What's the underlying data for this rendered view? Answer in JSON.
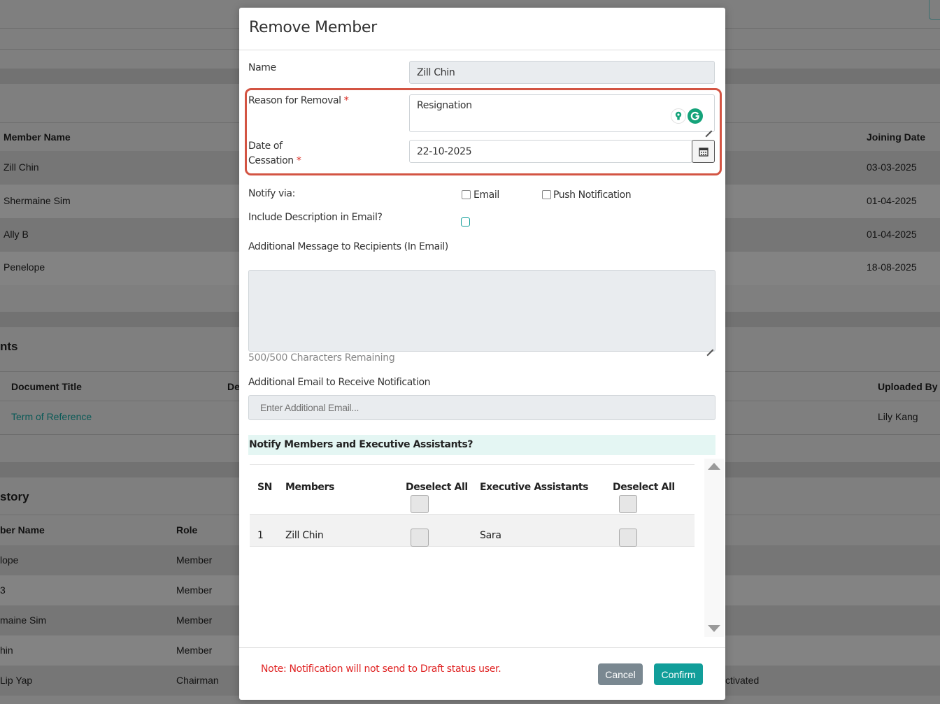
{
  "background": {
    "members_table": {
      "headers": [
        "Member Name",
        "Joining Date"
      ],
      "rows": [
        {
          "name": "Zill Chin",
          "date": "03-03-2025"
        },
        {
          "name": "Shermaine Sim",
          "date": "01-04-2025"
        },
        {
          "name": "Ally B",
          "date": "01-04-2025"
        },
        {
          "name": "Penelope",
          "date": "18-08-2025"
        }
      ]
    },
    "documents": {
      "heading_fragment": "nts",
      "headers": [
        "Document Title",
        "De",
        "Uploaded By"
      ],
      "row": {
        "title": "Term of Reference",
        "uploaded_by": "Lily Kang"
      }
    },
    "history": {
      "heading_fragment": "story",
      "headers": [
        "ber Name",
        "Role"
      ],
      "rows": [
        {
          "name": "lope",
          "role": "Member"
        },
        {
          "name": "3",
          "role": "Member"
        },
        {
          "name": "maine Sim",
          "role": "Member"
        },
        {
          "name": "hin",
          "role": "Member"
        },
        {
          "name": "Lip Yap",
          "role": "Chairman",
          "status": "ctivated"
        }
      ]
    }
  },
  "modal": {
    "title": "Remove Member",
    "name_label": "Name",
    "name_value": "Zill Chin",
    "reason_label": "Reason for Removal",
    "reason_value": "Resignation",
    "required_mark": "*",
    "date_label_line1": "Date of",
    "date_label_line2": "Cessation",
    "date_value": "22-10-2025",
    "notify_label": "Notify via:",
    "notify_email": "Email",
    "notify_push": "Push Notification",
    "include_desc_label": "Include Description in Email?",
    "additional_msg_label": "Additional Message to Recipients (In Email)",
    "additional_msg_value": "",
    "chars_remaining": "500/500 Characters Remaining",
    "additional_email_label": "Additional Email to Receive Notification",
    "additional_email_placeholder": "Enter Additional Email...",
    "notify_members_heading": "Notify Members and Executive Assistants?",
    "table": {
      "headers": {
        "sn": "SN",
        "members": "Members",
        "deselect_members": "Deselect All",
        "assistants": "Executive Assistants",
        "deselect_assistants": "Deselect All"
      },
      "rows": [
        {
          "sn": "1",
          "member": "Zill Chin",
          "assistant": "Sara"
        }
      ]
    },
    "note": "Note: Notification will not send to Draft status user.",
    "cancel_label": "Cancel",
    "confirm_label": "Confirm"
  },
  "colors": {
    "accent": "#119e9a",
    "required": "#d9261c",
    "highlight": "#d35443",
    "cancel": "#7a8891"
  }
}
